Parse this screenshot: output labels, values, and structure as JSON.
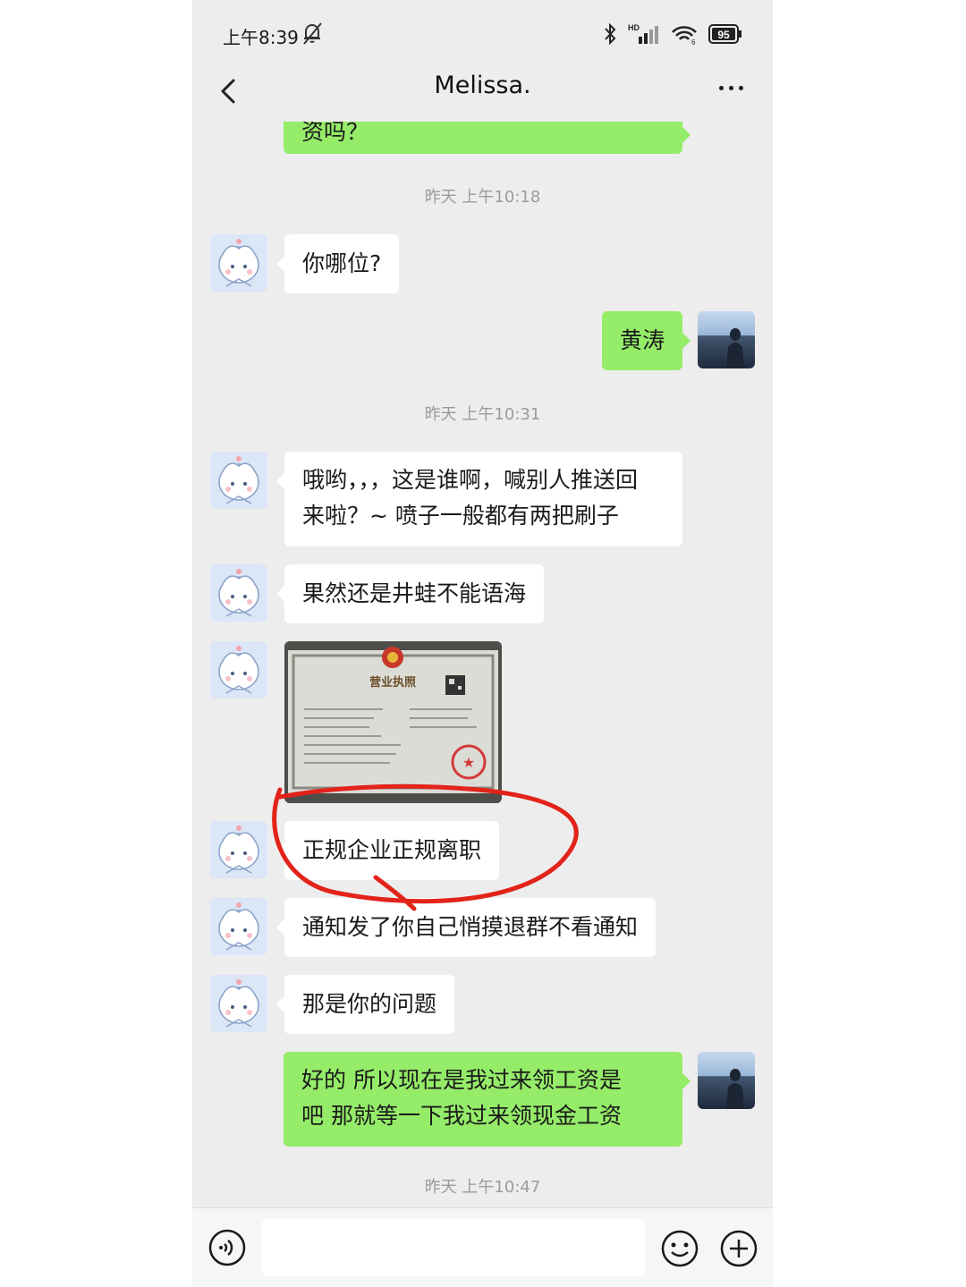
{
  "status_bar": {
    "time": "上午8:39",
    "battery": "95",
    "hd_label": "HD",
    "wifi_band": "6"
  },
  "header": {
    "title": "Melissa."
  },
  "timestamps": [
    "昨天 上午10:18",
    "昨天 上午10:31",
    "昨天 上午10:47"
  ],
  "messages": {
    "prev_out_tail": "资吗？",
    "m1": "你哪位?",
    "m2": "黄涛",
    "m3_line1": "哦哟，，，这是谁啊，喊别人推送回",
    "m3_line2": "来啦？~ 喷子一般都有两把刷子",
    "m4": "果然还是井蛙不能语海",
    "m5": "正规企业正规离职",
    "m6": "通知发了你自己悄摸退群不看通知",
    "m7": "那是你的问题",
    "m8_line1": "好的 所以现在是我过来领工资是",
    "m8_line2": "吧  那就等一下我过来领现金工资"
  },
  "license_image": {
    "title": "营业执照"
  },
  "annotation": {
    "type": "red-circle-highlight",
    "color": "#e2231a"
  },
  "colors": {
    "background": "#ededed",
    "outgoing": "#95ec69",
    "incoming": "#ffffff",
    "timestamp": "#9b9b9b"
  }
}
